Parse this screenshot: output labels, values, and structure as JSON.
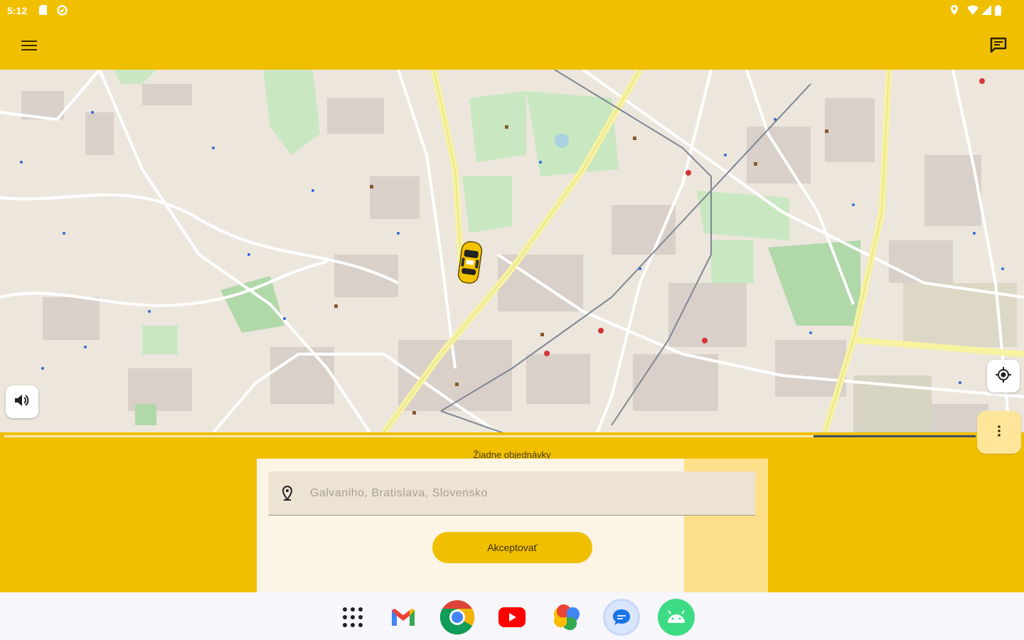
{
  "status_bar": {
    "time": "5:12",
    "left_icons": [
      "sd-card-icon",
      "sync-icon"
    ],
    "right_icons": [
      "location-icon",
      "wifi-icon",
      "signal-icon",
      "battery-icon"
    ]
  },
  "app_bar": {
    "menu_icon": "hamburger-menu-icon",
    "chat_icon": "chat-icon",
    "background_color": "#f0c000"
  },
  "map": {
    "car_icon": "taxi-car-icon",
    "sound_icon": "volume-icon",
    "locate_icon": "my-location-icon"
  },
  "progress": {
    "value": 0.17
  },
  "panel": {
    "caption": "Žiadne objednávky",
    "address_placeholder": "Galvaniho, Bratislava, Slovensko",
    "accept_label": "Akceptovať",
    "more_icon": "more-vertical-icon"
  },
  "dock": {
    "apps": [
      "App drawer",
      "Gmail",
      "Chrome",
      "YouTube",
      "Photos",
      "Messages",
      "Android"
    ]
  }
}
